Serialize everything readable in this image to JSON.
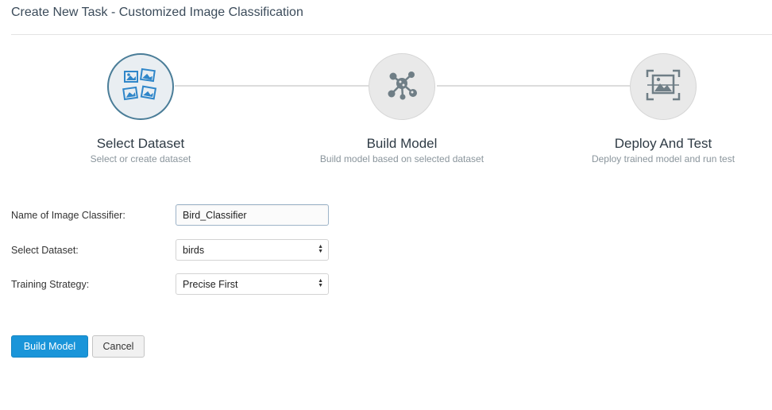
{
  "page": {
    "title": "Create New Task - Customized Image Classification"
  },
  "steps": [
    {
      "title": "Select Dataset",
      "subtitle": "Select or create dataset",
      "icon": "image-gallery-icon",
      "active": true
    },
    {
      "title": "Build Model",
      "subtitle": "Build model based on selected dataset",
      "icon": "network-model-icon",
      "active": false
    },
    {
      "title": "Deploy And Test",
      "subtitle": "Deploy trained model and run test",
      "icon": "image-scan-icon",
      "active": false
    }
  ],
  "form": {
    "classifier_name": {
      "label": "Name of Image Classifier:",
      "value": "Bird_Classifier"
    },
    "dataset": {
      "label": "Select Dataset:",
      "value": "birds"
    },
    "strategy": {
      "label": "Training Strategy:",
      "value": "Precise First"
    }
  },
  "actions": {
    "build_label": "Build Model",
    "cancel_label": "Cancel"
  },
  "colors": {
    "primary": "#1a95d9",
    "active_step_border": "#4a7d98",
    "icon_blue": "#2f86c9",
    "icon_gray": "#6f7e86"
  }
}
